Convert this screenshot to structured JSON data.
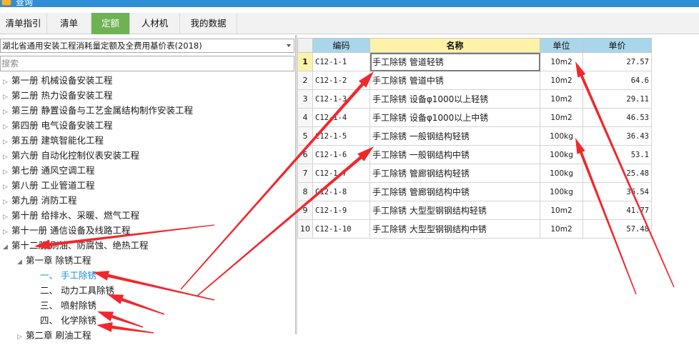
{
  "window": {
    "title": "查询"
  },
  "tabs": [
    {
      "label": "清单指引",
      "active": false
    },
    {
      "label": "清单",
      "active": false
    },
    {
      "label": "定额",
      "active": true
    },
    {
      "label": "人材机",
      "active": false
    },
    {
      "label": "我的数据",
      "active": false
    }
  ],
  "library": {
    "selected": "湖北省通用安装工程消耗量定额及全费用基价表(2018)"
  },
  "search": {
    "placeholder": "搜索"
  },
  "tree": [
    {
      "label": "第一册 机械设备安装工程",
      "level": 0,
      "expanded": false
    },
    {
      "label": "第二册 热力设备安装工程",
      "level": 0,
      "expanded": false
    },
    {
      "label": "第三册 静置设备与工艺金属结构制作安装工程",
      "level": 0,
      "expanded": false
    },
    {
      "label": "第四册 电气设备安装工程",
      "level": 0,
      "expanded": false
    },
    {
      "label": "第五册 建筑智能化工程",
      "level": 0,
      "expanded": false
    },
    {
      "label": "第六册 自动化控制仪表安装工程",
      "level": 0,
      "expanded": false
    },
    {
      "label": "第七册 通风空调工程",
      "level": 0,
      "expanded": false
    },
    {
      "label": "第八册 工业管道工程",
      "level": 0,
      "expanded": false
    },
    {
      "label": "第九册 消防工程",
      "level": 0,
      "expanded": false
    },
    {
      "label": "第十册 给排水、采暖、燃气工程",
      "level": 0,
      "expanded": false
    },
    {
      "label": "第十一册 通信设备及线路工程",
      "level": 0,
      "expanded": false
    },
    {
      "label": "第十二册 刷油、防腐蚀、绝热工程",
      "level": 0,
      "expanded": true
    },
    {
      "label": "第一章 除锈工程",
      "level": 1,
      "expanded": true
    },
    {
      "label": "一、 手工除锈",
      "level": 2,
      "selected": true
    },
    {
      "label": "二、 动力工具除锈",
      "level": 2
    },
    {
      "label": "三、 喷射除锈",
      "level": 2
    },
    {
      "label": "四、 化学除锈",
      "level": 2
    },
    {
      "label": "第二章 刷油工程",
      "level": 1,
      "expanded": false
    }
  ],
  "grid": {
    "columns": {
      "code": "编码",
      "name": "名称",
      "unit": "单位",
      "price": "单价"
    },
    "rows": [
      {
        "no": "1",
        "code": "C12-1-1",
        "name": "手工除锈 管道轻锈",
        "unit": "10m2",
        "price": "27.57"
      },
      {
        "no": "2",
        "code": "C12-1-2",
        "name": "手工除锈 管道中锈",
        "unit": "10m2",
        "price": "64.6"
      },
      {
        "no": "3",
        "code": "C12-1-3",
        "name": "手工除锈 设备φ1000以上轻锈",
        "unit": "10m2",
        "price": "29.11"
      },
      {
        "no": "4",
        "code": "C12-1-4",
        "name": "手工除锈 设备φ1000以上中锈",
        "unit": "10m2",
        "price": "46.53"
      },
      {
        "no": "5",
        "code": "C12-1-5",
        "name": "手工除锈 一般钢结构轻锈",
        "unit": "100kg",
        "price": "36.43"
      },
      {
        "no": "6",
        "code": "C12-1-6",
        "name": "手工除锈 一般钢结构中锈",
        "unit": "100kg",
        "price": "53.1"
      },
      {
        "no": "7",
        "code": "C12-1-7",
        "name": "手工除锈 管廊钢结构轻锈",
        "unit": "100kg",
        "price": "25.48"
      },
      {
        "no": "8",
        "code": "C12-1-8",
        "name": "手工除锈 管廊钢结构中锈",
        "unit": "100kg",
        "price": "36.54"
      },
      {
        "no": "9",
        "code": "C12-1-9",
        "name": "手工除锈 大型型钢钢结构轻锈",
        "unit": "10m2",
        "price": "41.77"
      },
      {
        "no": "10",
        "code": "C12-1-10",
        "name": "手工除锈 大型型钢钢结构中锈",
        "unit": "10m2",
        "price": "57.48"
      }
    ],
    "selected_row": 1
  },
  "colors": {
    "accent_tab": "#6fb253",
    "header": "#a9d6ea",
    "header_highlight": "#fdf2a7",
    "annotation": "#f0282d",
    "selected_text": "#1a8fe0"
  }
}
